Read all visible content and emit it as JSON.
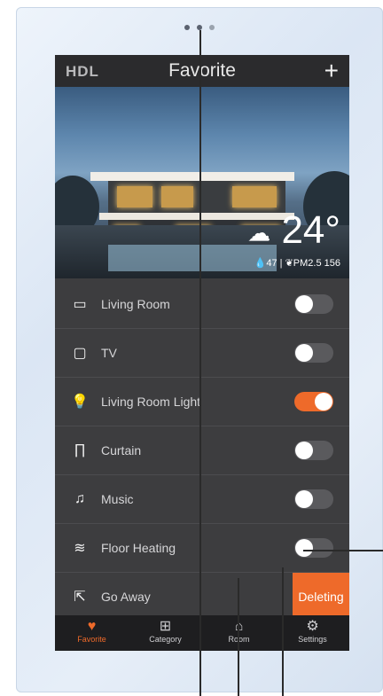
{
  "header": {
    "logo": "HDL",
    "title": "Favorite",
    "add_label": "+"
  },
  "weather": {
    "temperature": "24°",
    "humidity": "47",
    "pm_label": "PM2.5 156",
    "icon": "rain-cloud-icon"
  },
  "devices": [
    {
      "label": "Living Room",
      "icon": "air-conditioner-icon",
      "glyph": "▭",
      "on": false
    },
    {
      "label": "TV",
      "icon": "tv-icon",
      "glyph": "▢",
      "on": false
    },
    {
      "label": "Living Room Light",
      "icon": "light-bulb-icon",
      "glyph": "💡",
      "on": true
    },
    {
      "label": "Curtain",
      "icon": "curtain-icon",
      "glyph": "∏",
      "on": false
    },
    {
      "label": "Music",
      "icon": "music-note-icon",
      "glyph": "♫",
      "on": false
    },
    {
      "label": "Floor Heating",
      "icon": "floor-heating-icon",
      "glyph": "≋",
      "on": false
    }
  ],
  "scene": {
    "label": "Go Away",
    "icon": "go-away-icon",
    "glyph": "⇱",
    "action": "Deleting"
  },
  "tabs": [
    {
      "label": "Favorite",
      "icon": "heart-icon",
      "glyph": "♥",
      "active": true
    },
    {
      "label": "Category",
      "icon": "grid-icon",
      "glyph": "⊞",
      "active": false
    },
    {
      "label": "Room",
      "icon": "house-icon",
      "glyph": "⌂",
      "active": false
    },
    {
      "label": "Settings",
      "icon": "gear-icon",
      "glyph": "⚙",
      "active": false
    }
  ],
  "colors": {
    "accent": "#ee6a2a",
    "background": "#3d3d3f",
    "bar": "#1e1e20"
  }
}
